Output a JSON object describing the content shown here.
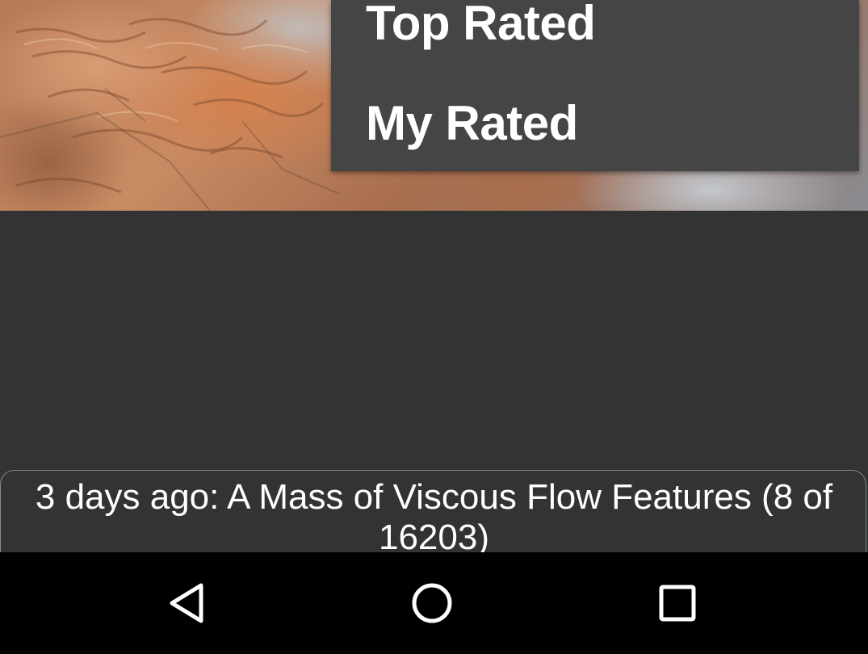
{
  "menu": {
    "items": [
      {
        "label": "Top Rated"
      },
      {
        "label": "My Rated"
      }
    ]
  },
  "image": {
    "icon": "mars-terrain-image"
  },
  "caption": {
    "text": "3 days ago: A Mass of Viscous Flow Features (8 of 16203)"
  },
  "navbar": {
    "icons": [
      "back-icon",
      "home-icon",
      "recents-icon"
    ]
  },
  "colors": {
    "background": "#333333",
    "menu_background": "#454545",
    "navbar_background": "#000000",
    "text": "#ffffff"
  }
}
